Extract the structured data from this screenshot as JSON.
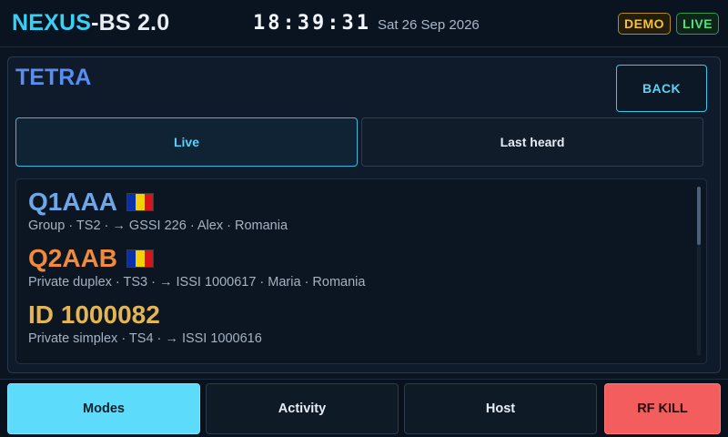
{
  "header": {
    "brand_accent": "NEXUS",
    "brand_rest": "-BS 2.0",
    "clock": "18:39:31",
    "date": "Sat 26 Sep 2026",
    "badges": {
      "demo": "DEMO",
      "live": "LIVE"
    }
  },
  "panel": {
    "title": "TETRA",
    "back_label": "BACK",
    "tabs": [
      {
        "label": "Live",
        "active": true
      },
      {
        "label": "Last heard",
        "active": false
      }
    ],
    "entries": [
      {
        "callsign": "Q1AAA",
        "flag": "romania-flag-icon",
        "meta": "Group · TS2 · → GSSI 226 · Alex · Romania",
        "color": "#6ea6e8"
      },
      {
        "callsign": "Q2AAB",
        "flag": "romania-flag-icon",
        "meta": "Private duplex · TS3 · → ISSI 1000617 · Maria · Romania",
        "color": "#f28a3c"
      },
      {
        "callsign": "ID 1000082",
        "flag": null,
        "meta": "Private simplex · TS4 · → ISSI 1000616",
        "color": "#e3b653"
      }
    ]
  },
  "footer": {
    "modes": "Modes",
    "activity": "Activity",
    "host": "Host",
    "rf_kill": "RF KILL"
  },
  "colors": {
    "accent": "#39d0f5",
    "title_blue": "#5a8df0",
    "danger": "#f45d5d"
  }
}
